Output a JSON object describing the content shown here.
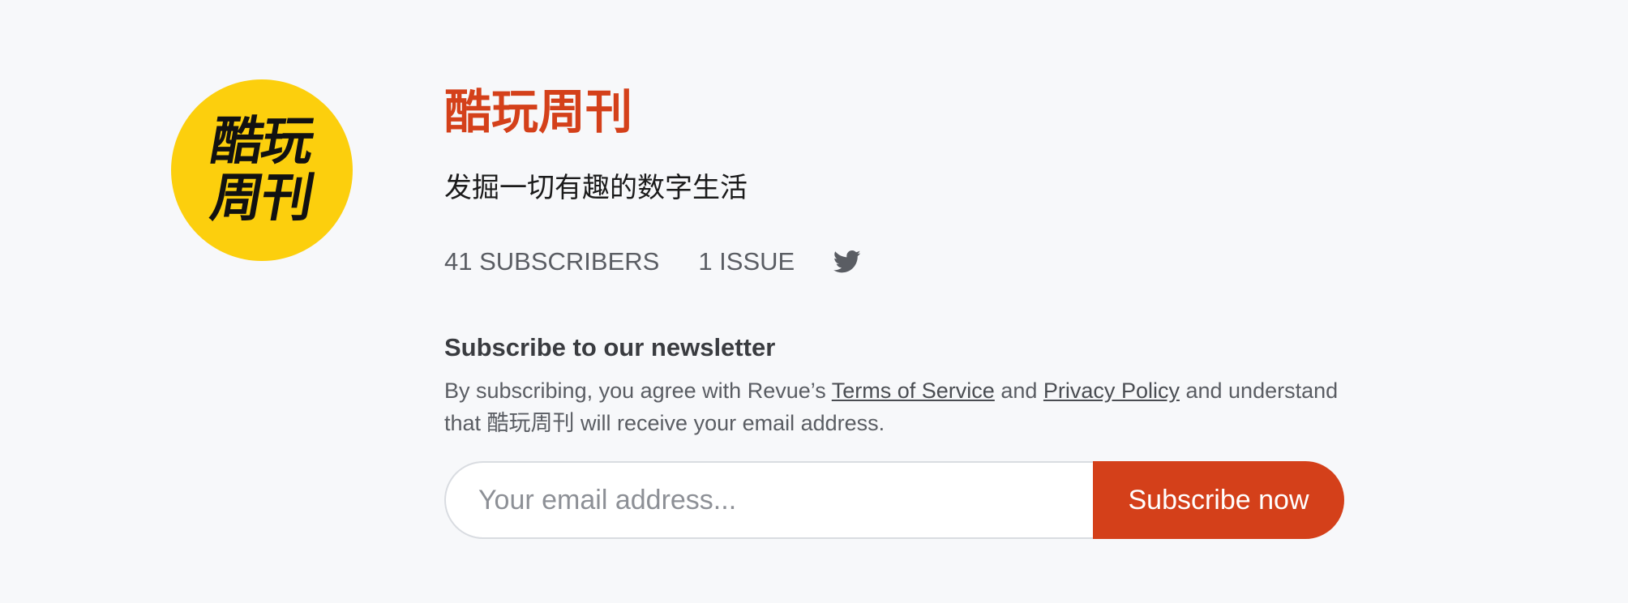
{
  "logo": {
    "line1": "酷玩",
    "line2": "周刊",
    "background_color": "#fccf0d"
  },
  "header": {
    "title": "酷玩周刊",
    "tagline": "发掘一切有趣的数字生活",
    "accent_color": "#d4401a"
  },
  "stats": {
    "subscribers": "41 SUBSCRIBERS",
    "issues": "1 ISSUE",
    "social_icon": "twitter-icon"
  },
  "subscribe": {
    "heading": "Subscribe to our newsletter",
    "consent_prefix": "By subscribing, you agree with Revue’s",
    "terms_link": "Terms of Service",
    "consent_and": "and",
    "privacy_link": "Privacy Policy",
    "consent_suffix": "and understand that 酷玩周刊 will receive your email address.",
    "email_placeholder": "Your email address...",
    "email_value": "",
    "button_label": "Subscribe now"
  }
}
